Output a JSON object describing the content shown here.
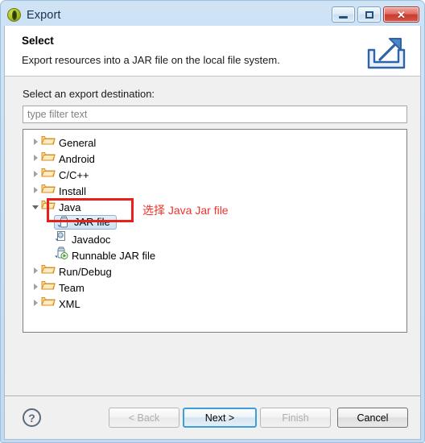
{
  "window": {
    "title": "Export",
    "app_icon": "eclipse-icon",
    "controls": {
      "minimize": "minimize-icon",
      "maximize": "restore-icon",
      "close": "close-icon",
      "close_glyph": "✕"
    }
  },
  "header": {
    "title": "Select",
    "description": "Export resources into a JAR file on the local file system.",
    "icon": "export-arrow-icon"
  },
  "form": {
    "destination_label": "Select an export destination:",
    "filter_placeholder": "type filter text",
    "filter_value": ""
  },
  "tree": {
    "items": [
      {
        "label": "General",
        "level": 0,
        "icon": "folder-icon",
        "state": "collapsed",
        "selected": false
      },
      {
        "label": "Android",
        "level": 0,
        "icon": "folder-icon",
        "state": "collapsed",
        "selected": false
      },
      {
        "label": "C/C++",
        "level": 0,
        "icon": "folder-icon",
        "state": "collapsed",
        "selected": false
      },
      {
        "label": "Install",
        "level": 0,
        "icon": "folder-icon",
        "state": "collapsed",
        "selected": false
      },
      {
        "label": "Java",
        "level": 0,
        "icon": "folder-icon",
        "state": "expanded",
        "selected": false
      },
      {
        "label": "JAR file",
        "level": 1,
        "icon": "jar-file-icon",
        "state": "leaf",
        "selected": true
      },
      {
        "label": "Javadoc",
        "level": 1,
        "icon": "javadoc-icon",
        "state": "leaf",
        "selected": false
      },
      {
        "label": "Runnable JAR file",
        "level": 1,
        "icon": "runnable-jar-icon",
        "state": "leaf",
        "selected": false
      },
      {
        "label": "Run/Debug",
        "level": 0,
        "icon": "folder-icon",
        "state": "collapsed",
        "selected": false
      },
      {
        "label": "Team",
        "level": 0,
        "icon": "folder-icon",
        "state": "collapsed",
        "selected": false
      },
      {
        "label": "XML",
        "level": 0,
        "icon": "folder-icon",
        "state": "collapsed",
        "selected": false
      }
    ]
  },
  "annotation": {
    "text": "选择 Java Jar file",
    "color": "#f0332c"
  },
  "footer": {
    "help_label": "?",
    "buttons": [
      {
        "label": "< Back",
        "name": "back-button",
        "enabled": false,
        "default": false
      },
      {
        "label": "Next >",
        "name": "next-button",
        "enabled": true,
        "default": true
      },
      {
        "label": "Finish",
        "name": "finish-button",
        "enabled": false,
        "default": false
      },
      {
        "label": "Cancel",
        "name": "cancel-button",
        "enabled": true,
        "default": false
      }
    ]
  },
  "colors": {
    "accent": "#3c9fd9",
    "annotation": "#e8201a",
    "selection": "#cfe1f3",
    "folder": "#f0a830"
  }
}
